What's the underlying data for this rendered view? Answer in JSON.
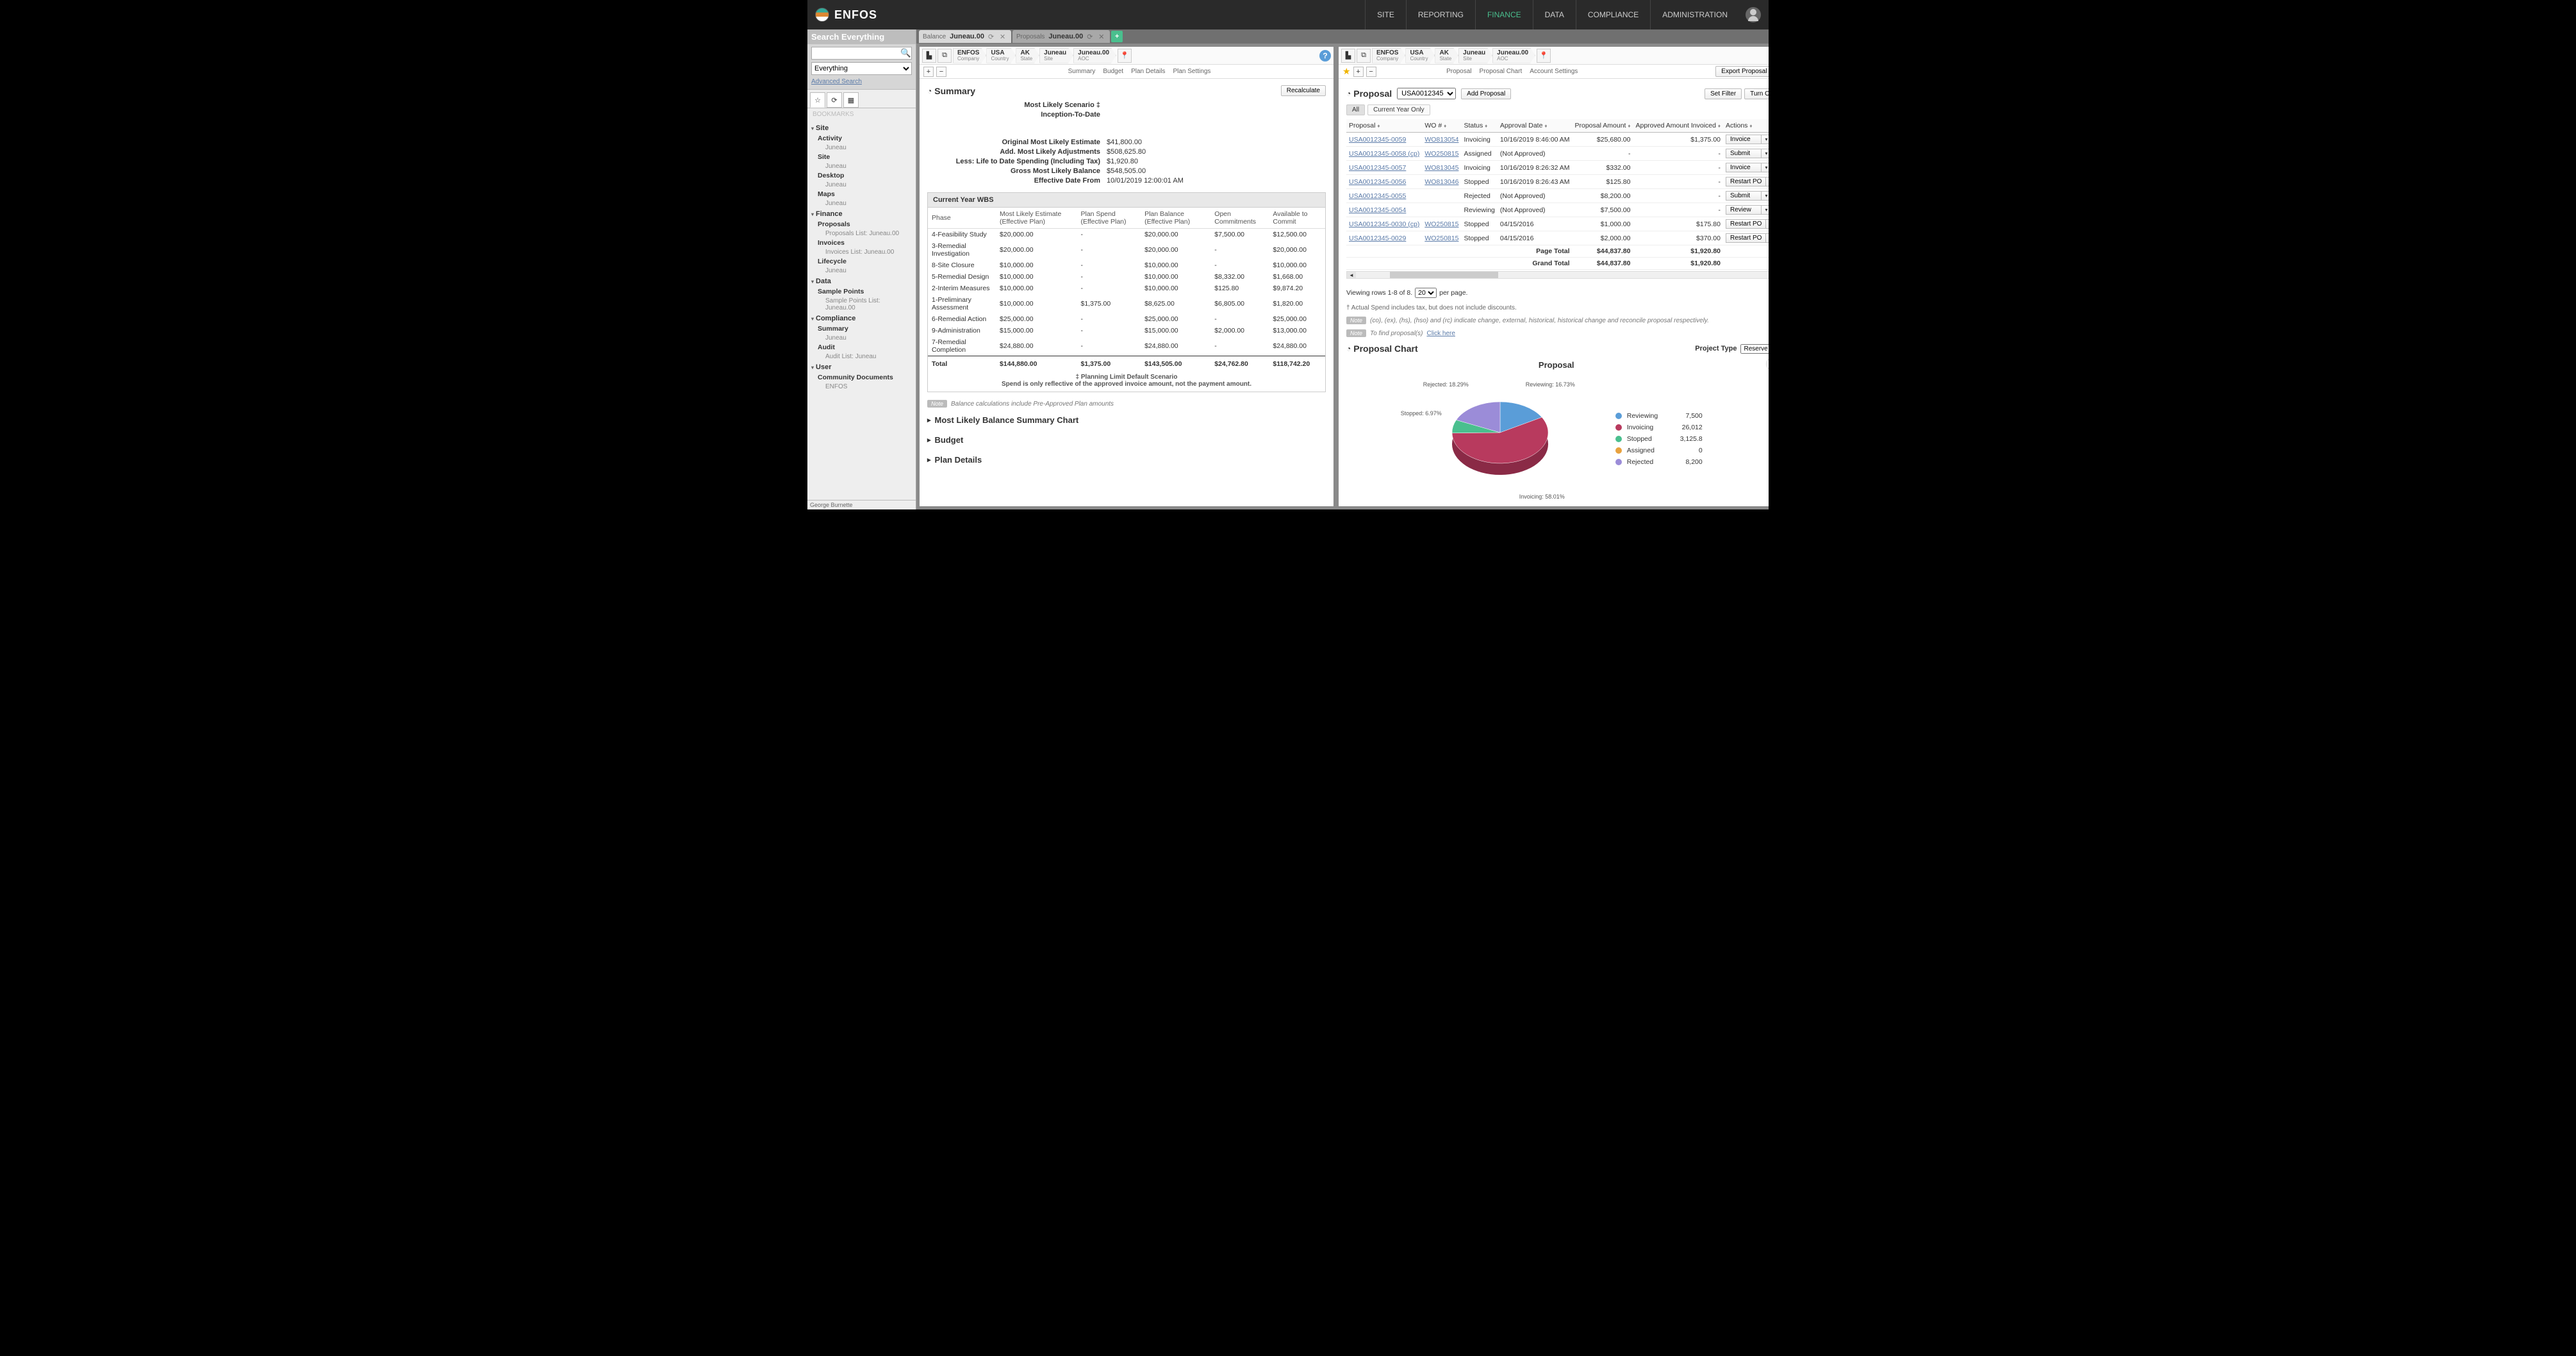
{
  "brand": "ENFOS",
  "topnav": {
    "items": [
      "SITE",
      "REPORTING",
      "FINANCE",
      "DATA",
      "COMPLIANCE",
      "ADMINISTRATION"
    ],
    "active": 2
  },
  "sidebar": {
    "search": {
      "title": "Search Everything",
      "placeholder": "",
      "scope": "Everything",
      "advanced": "Advanced Search"
    },
    "bookmarks_label": "BOOKMARKS",
    "footer_user": "George Burnette",
    "tree": [
      {
        "section": "Site",
        "items": [
          {
            "label": "Activity",
            "sub": "Juneau"
          },
          {
            "label": "Site",
            "sub": "Juneau"
          },
          {
            "label": "Desktop",
            "sub": "Juneau"
          },
          {
            "label": "Maps",
            "sub": "Juneau"
          }
        ]
      },
      {
        "section": "Finance",
        "items": [
          {
            "label": "Proposals",
            "sub": "Proposals List: Juneau.00"
          },
          {
            "label": "Invoices",
            "sub": "Invoices List: Juneau.00"
          },
          {
            "label": "Lifecycle",
            "sub": "Juneau"
          }
        ]
      },
      {
        "section": "Data",
        "items": [
          {
            "label": "Sample Points",
            "sub": "Sample Points List: Juneau.00"
          }
        ]
      },
      {
        "section": "Compliance",
        "items": [
          {
            "label": "Summary",
            "sub": "Juneau"
          },
          {
            "label": "Audit",
            "sub": "Audit List: Juneau"
          }
        ]
      },
      {
        "section": "User",
        "items": [
          {
            "label": "Community Documents",
            "sub": "ENFOS"
          }
        ]
      }
    ]
  },
  "doctabs": [
    {
      "prefix": "Balance",
      "name": "Juneau.00",
      "active": true
    },
    {
      "prefix": "Proposals",
      "name": "Juneau.00",
      "active": false
    }
  ],
  "breadcrumbs": [
    {
      "top": "ENFOS",
      "bot": "Company"
    },
    {
      "top": "USA",
      "bot": "Country"
    },
    {
      "top": "AK",
      "bot": "State"
    },
    {
      "top": "Juneau",
      "bot": "Site"
    },
    {
      "top": "Juneau.00",
      "bot": "AOC"
    }
  ],
  "left": {
    "subnav": [
      "Summary",
      "Budget",
      "Plan Details",
      "Plan Settings"
    ],
    "recalculate": "Recalculate",
    "summary_title": "Summary",
    "scenario_label": "Most Likely Scenario ‡",
    "scenario_sub": "Inception-To-Date",
    "metrics": [
      {
        "label": "Original Most Likely Estimate",
        "value": "$41,800.00"
      },
      {
        "label": "Add. Most Likely Adjustments",
        "value": "$508,625.80"
      },
      {
        "label": "Less: Life to Date Spending (Including Tax)",
        "value": "$1,920.80"
      },
      {
        "label": "Gross Most Likely Balance",
        "value": "$548,505.00"
      },
      {
        "label": "Effective Date From",
        "value": "10/01/2019 12:00:01 AM"
      }
    ],
    "wbs_title": "Current Year WBS",
    "wbs_cols": [
      "Phase",
      "Most Likely Estimate (Effective Plan)",
      "Plan Spend (Effective Plan)",
      "Plan Balance (Effective Plan)",
      "Open Commitments",
      "Available to Commit"
    ],
    "wbs_rows": [
      [
        "4-Feasibility Study",
        "$20,000.00",
        "-",
        "$20,000.00",
        "$7,500.00",
        "$12,500.00"
      ],
      [
        "3-Remedial Investigation",
        "$20,000.00",
        "-",
        "$20,000.00",
        "-",
        "$20,000.00"
      ],
      [
        "8-Site Closure",
        "$10,000.00",
        "-",
        "$10,000.00",
        "-",
        "$10,000.00"
      ],
      [
        "5-Remedial Design",
        "$10,000.00",
        "-",
        "$10,000.00",
        "$8,332.00",
        "$1,668.00"
      ],
      [
        "2-Interim Measures",
        "$10,000.00",
        "-",
        "$10,000.00",
        "$125.80",
        "$9,874.20"
      ],
      [
        "1-Preliminary Assessment",
        "$10,000.00",
        "$1,375.00",
        "$8,625.00",
        "$6,805.00",
        "$1,820.00"
      ],
      [
        "6-Remedial Action",
        "$25,000.00",
        "-",
        "$25,000.00",
        "-",
        "$25,000.00"
      ],
      [
        "9-Administration",
        "$15,000.00",
        "-",
        "$15,000.00",
        "$2,000.00",
        "$13,000.00"
      ],
      [
        "7-Remedial Completion",
        "$24,880.00",
        "-",
        "$24,880.00",
        "-",
        "$24,880.00"
      ]
    ],
    "wbs_total": [
      "Total",
      "$144,880.00",
      "$1,375.00",
      "$143,505.00",
      "$24,762.80",
      "$118,742.20"
    ],
    "footnote1": "‡ Planning Limit Default Scenario",
    "footnote2": "Spend is only reflective of the approved invoice amount, not the payment amount.",
    "note_balance": "Balance calculations include Pre-Approved Plan amounts",
    "collapsed": [
      "Most Likely Balance Summary Chart",
      "Budget",
      "Plan Details"
    ]
  },
  "right": {
    "subnav": [
      "Proposal",
      "Proposal Chart",
      "Account Settings"
    ],
    "export_label": "Export Proposal",
    "set_filter": "Set Filter",
    "turn_on": "Turn On",
    "proposal_title": "Proposal",
    "proposal_id": "USA0012345",
    "add_proposal": "Add Proposal",
    "filter_all": "All",
    "filter_cyo": "Current Year Only",
    "cols": [
      "Proposal",
      "WO #",
      "Status",
      "Approval Date",
      "Proposal Amount",
      "Approved Amount Invoiced",
      "Actions"
    ],
    "rows": [
      {
        "prop": "USA0012345-0059",
        "wo": "WO813054",
        "status": "Invoicing",
        "date": "10/16/2019 8:46:00 AM",
        "amount": "$25,680.00",
        "approved": "$1,375.00",
        "action": "Invoice"
      },
      {
        "prop": "USA0012345-0058 (cp)",
        "wo": "WO250815",
        "status": "Assigned",
        "date": "(Not Approved)",
        "amount": "-",
        "approved": "-",
        "action": "Submit"
      },
      {
        "prop": "USA0012345-0057",
        "wo": "WO813045",
        "status": "Invoicing",
        "date": "10/16/2019 8:26:32 AM",
        "amount": "$332.00",
        "approved": "-",
        "action": "Invoice"
      },
      {
        "prop": "USA0012345-0056",
        "wo": "WO813046",
        "status": "Stopped",
        "date": "10/16/2019 8:26:43 AM",
        "amount": "$125.80",
        "approved": "-",
        "action": "Restart PO"
      },
      {
        "prop": "USA0012345-0055",
        "wo": "",
        "status": "Rejected",
        "date": "(Not Approved)",
        "amount": "$8,200.00",
        "approved": "-",
        "action": "Submit"
      },
      {
        "prop": "USA0012345-0054",
        "wo": "",
        "status": "Reviewing",
        "date": "(Not Approved)",
        "amount": "$7,500.00",
        "approved": "-",
        "action": "Review"
      },
      {
        "prop": "USA0012345-0030 (cp)",
        "wo": "WO250815",
        "status": "Stopped",
        "date": "04/15/2016",
        "amount": "$1,000.00",
        "approved": "$175.80",
        "action": "Restart PO"
      },
      {
        "prop": "USA0012345-0029",
        "wo": "WO250815",
        "status": "Stopped",
        "date": "04/15/2016",
        "amount": "$2,000.00",
        "approved": "$370.00",
        "action": "Restart PO"
      }
    ],
    "page_total": {
      "label": "Page Total",
      "amount": "$44,837.80",
      "approved": "$1,920.80"
    },
    "grand_total": {
      "label": "Grand Total",
      "amount": "$44,837.80",
      "approved": "$1,920.80"
    },
    "pager_text_a": "Viewing rows 1-8 of 8.",
    "pager_size": "20",
    "pager_text_b": "per page.",
    "spend_note": "† Actual Spend includes tax, but does not include discounts.",
    "legend_note": "(co), (ex), (hs), (hso) and (rc) indicate change, external, historical, historical change and reconcile proposal respectively.",
    "find_note": "To find proposal(s) ",
    "find_link": "Click here",
    "chartsec_title": "Proposal Chart",
    "project_type_label": "Project Type",
    "project_type_value": "Reserve",
    "chart_title": "Proposal",
    "legend": [
      {
        "label": "Reviewing",
        "value": "7,500",
        "color": "#5a9dd8"
      },
      {
        "label": "Invoicing",
        "value": "26,012",
        "color": "#b83a5e"
      },
      {
        "label": "Stopped",
        "value": "3,125.8",
        "color": "#4abf8e"
      },
      {
        "label": "Assigned",
        "value": "0",
        "color": "#e8a23f"
      },
      {
        "label": "Rejected",
        "value": "8,200",
        "color": "#9b8cd8"
      }
    ],
    "pie_labels": {
      "reviewing": "Reviewing: 16.73%",
      "invoicing": "Invoicing: 58.01%",
      "stopped": "Stopped: 6.97%",
      "rejected": "Rejected: 18.29%"
    }
  },
  "chart_data": {
    "type": "pie",
    "title": "Proposal",
    "series": [
      {
        "name": "Proposal",
        "slices": [
          {
            "label": "Reviewing",
            "value": 7500,
            "pct": 16.73,
            "color": "#5a9dd8"
          },
          {
            "label": "Invoicing",
            "value": 26012,
            "pct": 58.01,
            "color": "#b83a5e"
          },
          {
            "label": "Stopped",
            "value": 3125.8,
            "pct": 6.97,
            "color": "#4abf8e"
          },
          {
            "label": "Assigned",
            "value": 0,
            "pct": 0,
            "color": "#e8a23f"
          },
          {
            "label": "Rejected",
            "value": 8200,
            "pct": 18.29,
            "color": "#9b8cd8"
          }
        ]
      }
    ]
  }
}
